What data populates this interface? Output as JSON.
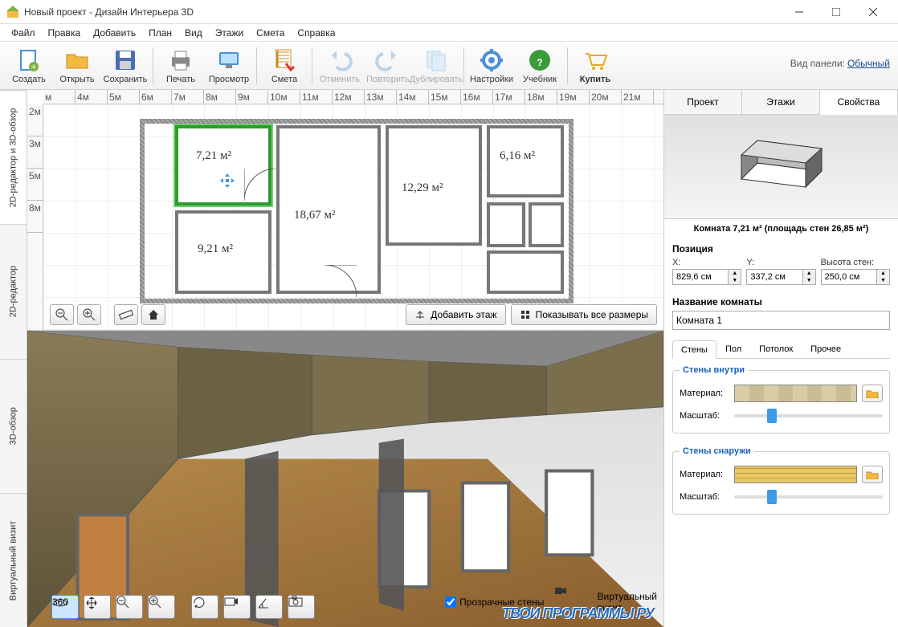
{
  "window": {
    "title": "Новый проект - Дизайн Интерьера 3D"
  },
  "menu": [
    "Файл",
    "Правка",
    "Добавить",
    "План",
    "Вид",
    "Этажи",
    "Смета",
    "Справка"
  ],
  "toolbar": [
    {
      "id": "create",
      "label": "Создать"
    },
    {
      "id": "open",
      "label": "Открыть"
    },
    {
      "id": "save",
      "label": "Сохранить"
    },
    {
      "sep": true
    },
    {
      "id": "print",
      "label": "Печать"
    },
    {
      "id": "preview",
      "label": "Просмотр"
    },
    {
      "sep": true
    },
    {
      "id": "estimate",
      "label": "Смета"
    },
    {
      "sep": true
    },
    {
      "id": "undo",
      "label": "Отменить",
      "disabled": true
    },
    {
      "id": "redo",
      "label": "Повторить",
      "disabled": true
    },
    {
      "id": "duplicate",
      "label": "Дублировать",
      "disabled": true
    },
    {
      "sep": true
    },
    {
      "id": "settings",
      "label": "Настройки"
    },
    {
      "id": "tutorial",
      "label": "Учебник"
    },
    {
      "sep": true
    },
    {
      "id": "buy",
      "label": "Купить"
    }
  ],
  "panel_mode": {
    "label": "Вид панели:",
    "value": "Обычный"
  },
  "vtabs": [
    "2D-редактор и 3D-обзор",
    "2D-редактор",
    "3D-обзор",
    "Виртуальный визит"
  ],
  "ruler_h": [
    "м",
    "4м",
    "5м",
    "6м",
    "7м",
    "8м",
    "9м",
    "10м",
    "11м",
    "12м",
    "13м",
    "14м",
    "15м",
    "16м",
    "17м",
    "18м",
    "19м",
    "20м",
    "21м"
  ],
  "ruler_v": [
    "2м",
    "3м",
    "5м",
    "8м"
  ],
  "rooms": {
    "r1": "7,21 м²",
    "r2": "18,67 м²",
    "r3": "12,29 м²",
    "r4": "6,16 м²",
    "r5": "9,21 м²"
  },
  "plan_buttons": {
    "add_floor": "Добавить этаж",
    "show_dims": "Показывать все размеры"
  },
  "view3d_buttons": {
    "transparent_walls": "Прозрачные стены",
    "virtual_visit": "Виртуальный визит"
  },
  "right": {
    "tabs": [
      "Проект",
      "Этажи",
      "Свойства"
    ],
    "room_info": "Комната 7,21 м²  (площадь стен 26,85 м²)",
    "position_head": "Позиция",
    "x_label": "X:",
    "x_val": "829,6 см",
    "y_label": "Y:",
    "y_val": "337,2 см",
    "h_label": "Высота стен:",
    "h_val": "250,0 см",
    "name_head": "Название комнаты",
    "name_val": "Комната 1",
    "subtabs": [
      "Стены",
      "Пол",
      "Потолок",
      "Прочее"
    ],
    "inside_head": "Стены внутри",
    "outside_head": "Стены снаружи",
    "material_label": "Материал:",
    "scale_label": "Масштаб:"
  },
  "watermark": "ТВОИ ПРОГРАММЫ РУ"
}
